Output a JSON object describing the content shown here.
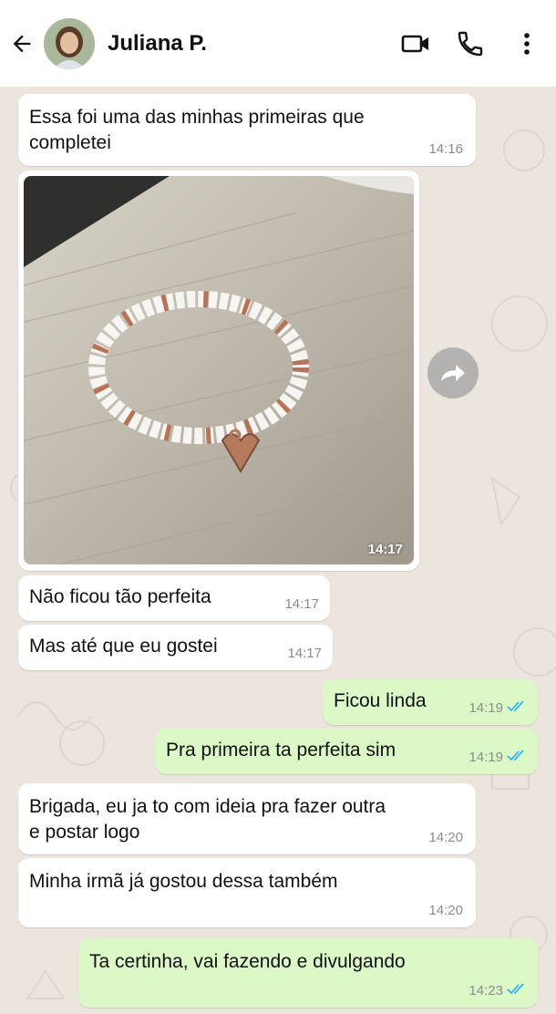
{
  "header": {
    "contact_name": "Juliana P.",
    "back_icon": "arrow-left-icon",
    "video_icon": "video-call-icon",
    "call_icon": "phone-icon",
    "menu_icon": "more-vertical-icon"
  },
  "colors": {
    "incoming_bubble": "#ffffff",
    "outgoing_bubble": "#dcf8c6",
    "background": "#ece5dd",
    "read_ticks": "#34b7f1"
  },
  "messages": [
    {
      "direction": "in",
      "text": "Essa foi uma das minhas primeiras que\ncompletei",
      "time": "14:16"
    },
    {
      "direction": "in",
      "type": "image",
      "description_icon": "bracelet-photo",
      "time": "14:17"
    },
    {
      "direction": "in",
      "text": "Não ficou tão perfeita",
      "time": "14:17"
    },
    {
      "direction": "in",
      "text": "Mas até que eu gostei",
      "time": "14:17"
    },
    {
      "direction": "out",
      "text": "Ficou linda",
      "time": "14:19",
      "status": "read"
    },
    {
      "direction": "out",
      "text": "Pra primeira ta perfeita sim",
      "time": "14:19",
      "status": "read"
    },
    {
      "direction": "in",
      "text": "Brigada, eu ja to com ideia pra fazer outra\ne postar logo",
      "time": "14:20"
    },
    {
      "direction": "in",
      "text": "Minha irmã já gostou dessa também",
      "time": "14:20"
    },
    {
      "direction": "out",
      "text": "Ta certinha, vai fazendo e divulgando",
      "time": "14:23",
      "status": "read"
    }
  ]
}
